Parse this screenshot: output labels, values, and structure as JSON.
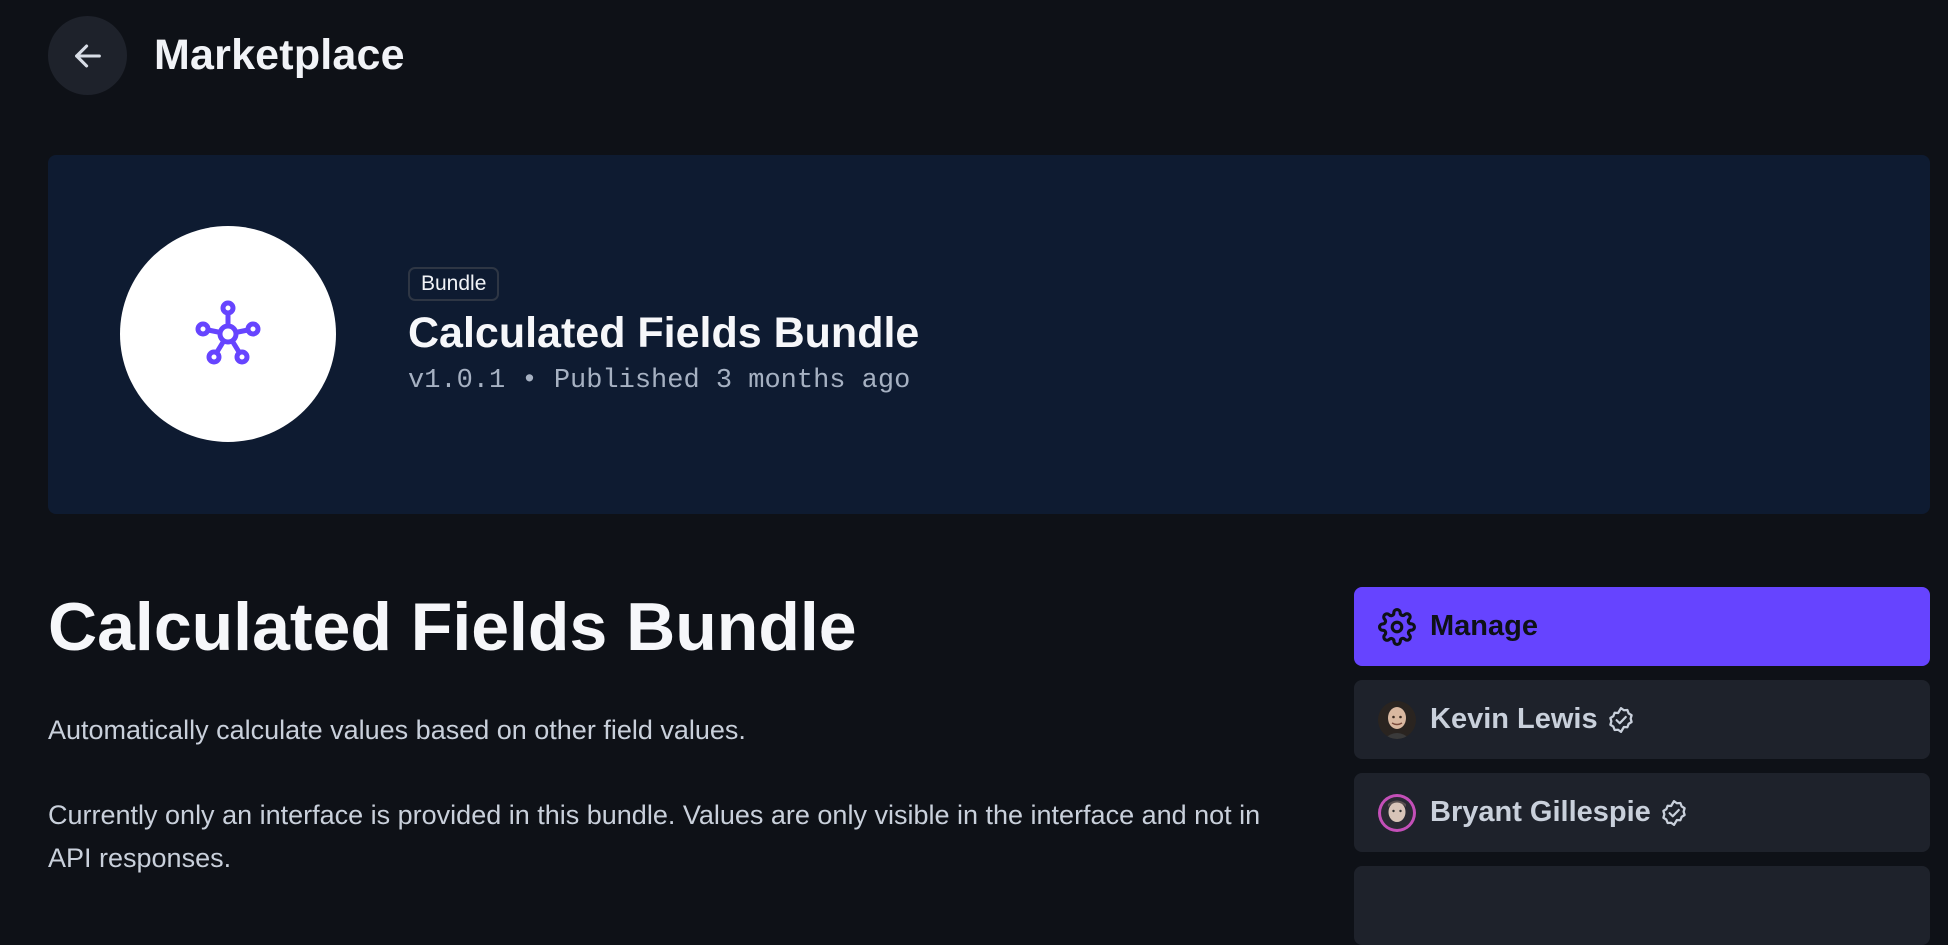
{
  "header": {
    "title": "Marketplace",
    "back_icon": "arrow-left-icon"
  },
  "banner": {
    "badge": "Bundle",
    "title": "Calculated Fields Bundle",
    "meta": "v1.0.1 • Published 3 months ago",
    "logo_icon": "hub-nodes-icon",
    "logo_color": "#6644ff",
    "background": "#0e1b31"
  },
  "main": {
    "title": "Calculated Fields Bundle",
    "description_1": "Automatically calculate values based on other field values.",
    "description_2": "Currently only an interface is provided in this bundle. Values are only visible in the interface and not in API responses."
  },
  "sidebar": {
    "manage_label": "Manage",
    "manage_icon": "gear-icon",
    "accent": "#6644ff",
    "people": [
      {
        "name": "Kevin Lewis",
        "verified": true
      },
      {
        "name": "Bryant Gillespie",
        "verified": true
      }
    ]
  }
}
